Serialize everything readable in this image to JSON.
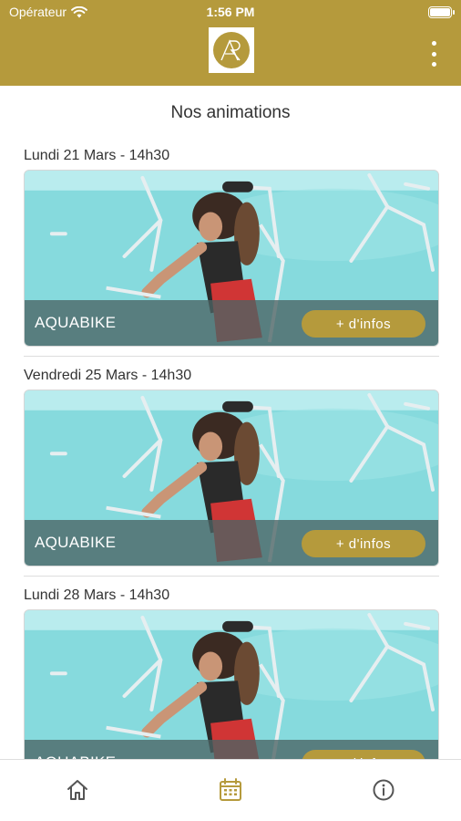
{
  "status_bar": {
    "carrier": "Opérateur",
    "time": "1:56 PM"
  },
  "header": {
    "logo_icon": "ar-monogram-logo",
    "menu_icon": "more-vertical-icon"
  },
  "page_title": "Nos animations",
  "events": [
    {
      "date": "Lundi 21 Mars - 14h30",
      "name": "AQUABIKE",
      "info_label": "+ d'infos"
    },
    {
      "date": "Vendredi 25 Mars - 14h30",
      "name": "AQUABIKE",
      "info_label": "+ d'infos"
    },
    {
      "date": "Lundi 28 Mars - 14h30",
      "name": "AQUABIKE",
      "info_label": "+ d'infos"
    }
  ],
  "tabbar": {
    "items": [
      {
        "icon": "home-icon",
        "active": false
      },
      {
        "icon": "calendar-icon",
        "active": true
      },
      {
        "icon": "info-icon",
        "active": false
      }
    ]
  },
  "colors": {
    "brand_gold": "#b59a3c",
    "banner": "#4b6464",
    "pool_water": "#7fd8dc",
    "tab_inactive": "#555555"
  }
}
